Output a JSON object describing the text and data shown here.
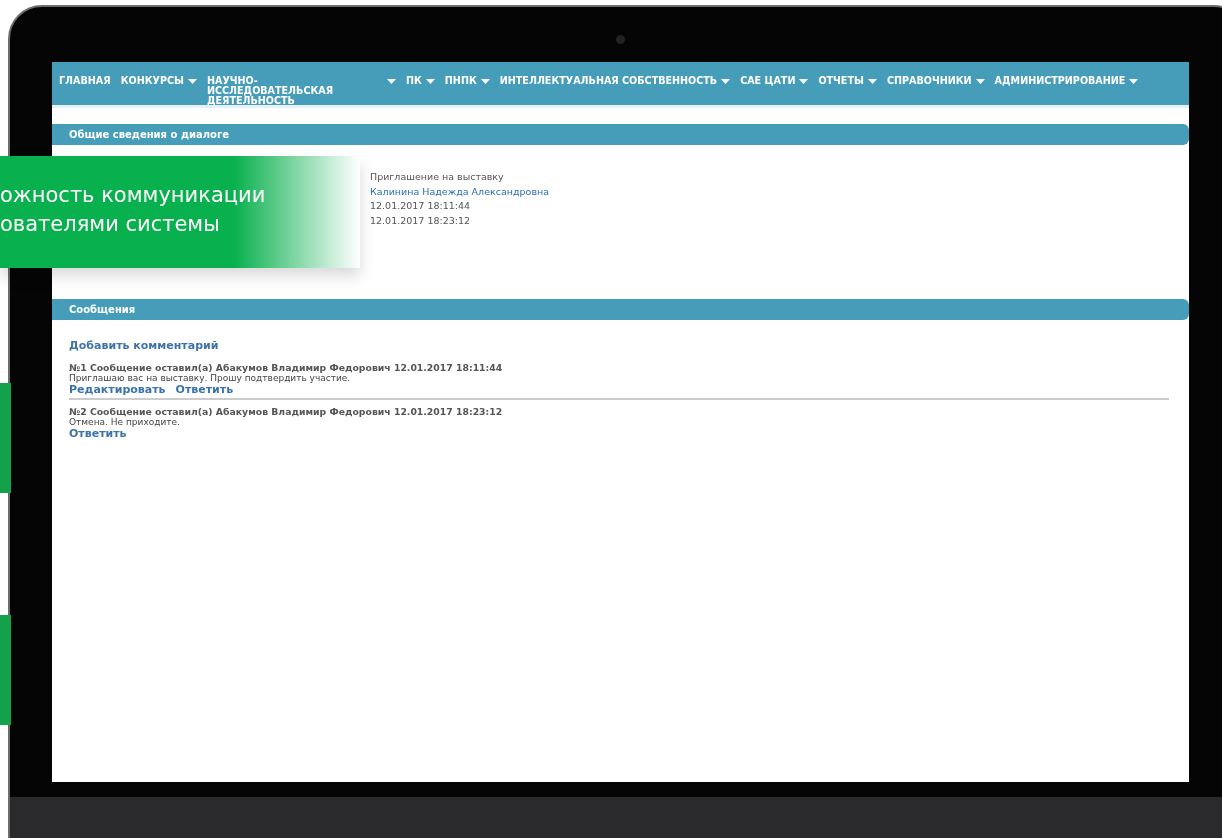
{
  "nav": [
    {
      "label": "ГЛАВНАЯ",
      "dropdown": false
    },
    {
      "label": "КОНКУРСЫ",
      "dropdown": true
    },
    {
      "label": "НАУЧНО-ИССЛЕДОВАТЕЛЬСКАЯ ДЕЯТЕЛЬНОСТЬ",
      "dropdown": true
    },
    {
      "label": "ПК",
      "dropdown": true
    },
    {
      "label": "ПНПК",
      "dropdown": true
    },
    {
      "label": "ИНТЕЛЛЕКТУАЛЬНАЯ СОБСТВЕННОСТЬ",
      "dropdown": true
    },
    {
      "label": "САЕ ЦАТИ",
      "dropdown": true
    },
    {
      "label": "ОТЧЕТЫ",
      "dropdown": true
    },
    {
      "label": "СПРАВОЧНИКИ",
      "dropdown": true
    },
    {
      "label": "АДМИНИСТРИРОВАНИЕ",
      "dropdown": true
    }
  ],
  "dialog_info": {
    "title": "Общие сведения о диалоге",
    "fields": [
      {
        "value": "Приглашение на выставку",
        "kind": "text"
      },
      {
        "value": "Калинина Надежда Александровна",
        "kind": "link"
      },
      {
        "value": "12.01.2017 18:11:44",
        "kind": "text"
      },
      {
        "value": "12.01.2017 18:23:12",
        "kind": "text"
      }
    ]
  },
  "banner": {
    "lines": [
      "ожность коммуникации",
      "ователями системы"
    ]
  },
  "messages": {
    "title": "Сообщения",
    "add_comment": "Добавить комментарий",
    "items": [
      {
        "header": "№1 Сообщение оставил(а) Абакумов Владимир Федорович 12.01.2017 18:11:44",
        "text": "Приглашаю вас на выставку. Прошу подтвердить участие.",
        "actions": [
          "Редактировать",
          "Ответить"
        ]
      },
      {
        "header": "№2 Сообщение оставил(а) Абакумов Владимир Федорович 12.01.2017 18:23:12",
        "text": "Отмена. Не приходите.",
        "actions": [
          "Ответить"
        ]
      }
    ]
  }
}
